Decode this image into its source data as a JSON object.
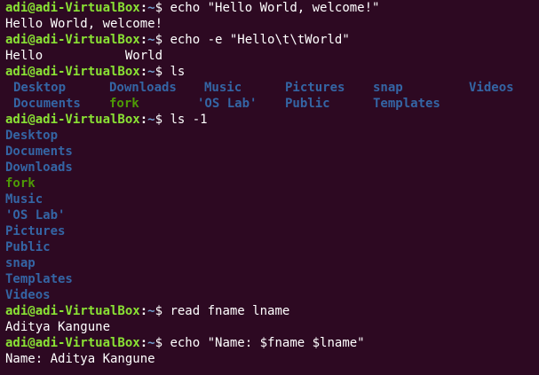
{
  "prompt": {
    "user_host": "adi@adi-VirtualBox",
    "colon": ":",
    "path": "~",
    "dollar": "$ "
  },
  "session": [
    {
      "cmd": "echo \"Hello World, welcome!\""
    },
    {
      "out": "Hello World, welcome!"
    },
    {
      "cmd": "echo -e \"Hello\\t\\tWorld\""
    },
    {
      "out": "Hello           World"
    },
    {
      "cmd": "ls"
    },
    {
      "cmd": "ls -1"
    },
    {
      "cmd": "read fname lname"
    },
    {
      "out": "Aditya Kangune"
    },
    {
      "cmd": "echo \"Name: $fname $lname\""
    },
    {
      "out": "Name: Aditya Kangune"
    }
  ],
  "ls_grid": {
    "row1": [
      "Desktop",
      "Downloads",
      "Music",
      "Pictures",
      "snap",
      "Videos"
    ],
    "row2": [
      "Documents",
      "fork",
      "'OS Lab'",
      "Public",
      "Templates"
    ]
  },
  "ls_list": [
    "Desktop",
    "Documents",
    "Downloads",
    "fork",
    "Music",
    "'OS Lab'",
    "Pictures",
    "Public",
    "snap",
    "Templates",
    "Videos"
  ],
  "colors": {
    "background": "#2d0922",
    "prompt_user": "#8ae234",
    "prompt_path": "#729fcf",
    "directory": "#3465a4",
    "executable": "#4e9a06",
    "text": "#ffffff"
  }
}
